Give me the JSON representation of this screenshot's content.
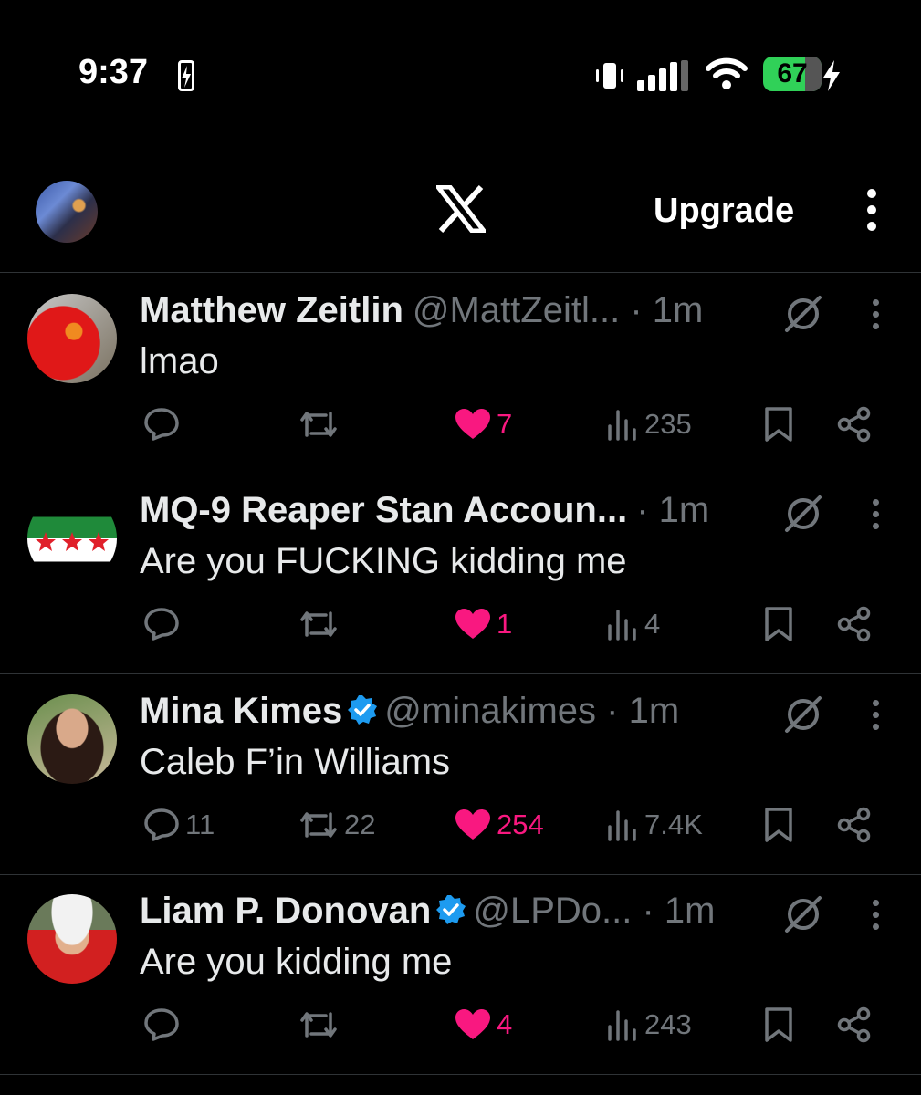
{
  "status_bar": {
    "time": "9:37",
    "battery": "67"
  },
  "header": {
    "upgrade_label": "Upgrade"
  },
  "tweets": [
    {
      "name": "Matthew Zeitlin",
      "verified": false,
      "handle": "@MattZeitl...",
      "sep": "·",
      "time": "1m",
      "text": "lmao",
      "replies": "",
      "reposts": "",
      "likes": "7",
      "views": "235"
    },
    {
      "name": "MQ-9 Reaper Stan Accoun...",
      "verified": false,
      "handle": "",
      "sep": "·",
      "time": "1m",
      "text": "Are you FUCKING kidding me",
      "replies": "",
      "reposts": "",
      "likes": "1",
      "views": "4"
    },
    {
      "name": "Mina Kimes",
      "verified": true,
      "handle": "@minakimes",
      "sep": "·",
      "time": "1m",
      "text": "Caleb F’in Williams",
      "replies": "11",
      "reposts": "22",
      "likes": "254",
      "views": "7.4K"
    },
    {
      "name": "Liam P. Donovan",
      "verified": true,
      "handle": "@LPDo...",
      "sep": "·",
      "time": "1m",
      "text": "Are you kidding me",
      "replies": "",
      "reposts": "",
      "likes": "4",
      "views": "243"
    }
  ],
  "colors": {
    "like": "#f91880",
    "verified": "#1d9bf0",
    "battery": "#30d158",
    "muted": "#71767b"
  }
}
